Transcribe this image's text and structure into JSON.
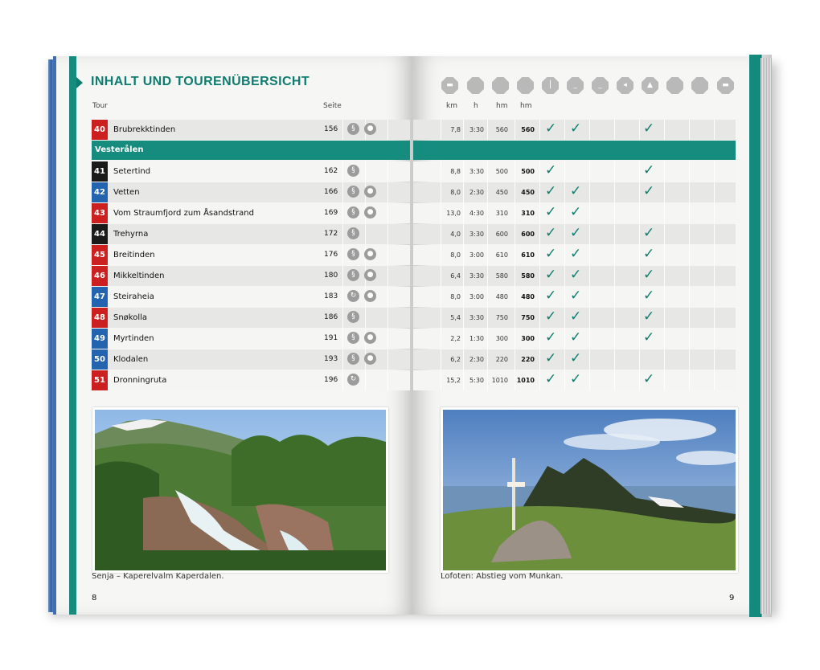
{
  "header": {
    "title": "INHALT UND TOURENÜBERSICHT",
    "col_tour": "Tour",
    "col_seite": "Seite",
    "col_km": "km",
    "col_h": "h",
    "col_hm_up": "hm",
    "col_hm_down": "hm"
  },
  "section": {
    "label": "Vesterålen"
  },
  "rows": [
    {
      "nr": "40",
      "color": "red",
      "name": "Brubrekktinden",
      "seite": "156",
      "km": "7,8",
      "h": "3:30",
      "hm1": "560",
      "hm2": "560",
      "c1": "✓",
      "c2": "✓",
      "c5": "✓"
    },
    {
      "nr": "41",
      "color": "black",
      "name": "Setertind",
      "seite": "162",
      "km": "8,8",
      "h": "3:30",
      "hm1": "500",
      "hm2": "500",
      "c1": "✓",
      "c2": "",
      "c5": "✓"
    },
    {
      "nr": "42",
      "color": "blue",
      "name": "Vetten",
      "seite": "166",
      "km": "8,0",
      "h": "2:30",
      "hm1": "450",
      "hm2": "450",
      "c1": "✓",
      "c2": "✓",
      "c5": "✓"
    },
    {
      "nr": "43",
      "color": "red",
      "name": "Vom Straumfjord zum Åsandstrand",
      "seite": "169",
      "km": "13,0",
      "h": "4:30",
      "hm1": "310",
      "hm2": "310",
      "c1": "✓",
      "c2": "✓",
      "c5": ""
    },
    {
      "nr": "44",
      "color": "black",
      "name": "Trehyrna",
      "seite": "172",
      "km": "4,0",
      "h": "3:30",
      "hm1": "600",
      "hm2": "600",
      "c1": "✓",
      "c2": "✓",
      "c5": "✓"
    },
    {
      "nr": "45",
      "color": "red",
      "name": "Breitinden",
      "seite": "176",
      "km": "8,0",
      "h": "3:00",
      "hm1": "610",
      "hm2": "610",
      "c1": "✓",
      "c2": "✓",
      "c5": "✓"
    },
    {
      "nr": "46",
      "color": "red",
      "name": "Mikkeltinden",
      "seite": "180",
      "km": "6,4",
      "h": "3:30",
      "hm1": "580",
      "hm2": "580",
      "c1": "✓",
      "c2": "✓",
      "c5": "✓"
    },
    {
      "nr": "47",
      "color": "blue",
      "name": "Steiraheia",
      "seite": "183",
      "km": "8,0",
      "h": "3:00",
      "hm1": "480",
      "hm2": "480",
      "c1": "✓",
      "c2": "✓",
      "c5": "✓"
    },
    {
      "nr": "48",
      "color": "red",
      "name": "Snøkolla",
      "seite": "186",
      "km": "5,4",
      "h": "3:30",
      "hm1": "750",
      "hm2": "750",
      "c1": "✓",
      "c2": "✓",
      "c5": "✓"
    },
    {
      "nr": "49",
      "color": "blue",
      "name": "Myrtinden",
      "seite": "191",
      "km": "2,2",
      "h": "1:30",
      "hm1": "300",
      "hm2": "300",
      "c1": "✓",
      "c2": "✓",
      "c5": "✓"
    },
    {
      "nr": "50",
      "color": "blue",
      "name": "Klodalen",
      "seite": "193",
      "km": "6,2",
      "h": "2:30",
      "hm1": "220",
      "hm2": "220",
      "c1": "✓",
      "c2": "✓",
      "c5": ""
    },
    {
      "nr": "51",
      "color": "red",
      "name": "Dronningruta",
      "seite": "196",
      "km": "15,2",
      "h": "5:30",
      "hm1": "1010",
      "hm2": "1010",
      "c1": "✓",
      "c2": "✓",
      "c5": "✓"
    }
  ],
  "captions": {
    "left": "Senja – Kaperelvalm Kaperdalen.",
    "right": "Lofoten: Abstieg vom Munkan."
  },
  "page_numbers": {
    "left": "8",
    "right": "9"
  },
  "colors": {
    "teal": "#168c7e",
    "red": "#cc1f1f",
    "blue": "#2463ad",
    "black": "#1a1a1a"
  }
}
